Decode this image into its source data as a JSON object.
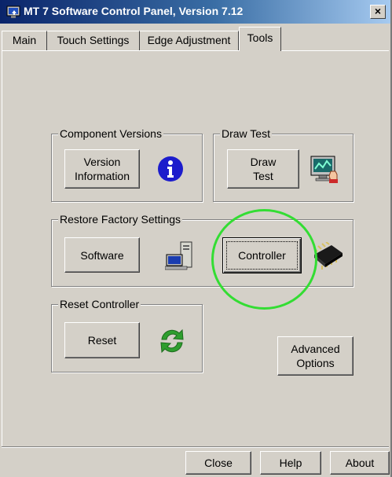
{
  "window": {
    "title": "MT 7 Software Control Panel, Version 7.12",
    "close_glyph": "×"
  },
  "tabs": [
    {
      "label": "Main",
      "active": false
    },
    {
      "label": "Touch Settings",
      "active": false
    },
    {
      "label": "Edge Adjustment",
      "active": false
    },
    {
      "label": "Tools",
      "active": true
    }
  ],
  "groups": {
    "component_versions": {
      "legend": "Component Versions",
      "button_line1": "Version",
      "button_line2": "Information",
      "icon": "info-icon"
    },
    "draw_test": {
      "legend": "Draw Test",
      "button_line1": "Draw",
      "button_line2": "Test",
      "icon": "monitor-draw-icon"
    },
    "restore_factory": {
      "legend": "Restore Factory Settings",
      "software_label": "Software",
      "controller_label": "Controller",
      "software_icon": "computer-icon",
      "controller_icon": "chip-icon"
    },
    "reset_controller": {
      "legend": "Reset Controller",
      "button_label": "Reset",
      "icon": "refresh-icon"
    }
  },
  "advanced": {
    "line1": "Advanced",
    "line2": "Options"
  },
  "footer": {
    "close": "Close",
    "help": "Help",
    "about": "About"
  },
  "colors": {
    "face": "#d4d0c8",
    "title_start": "#0a246a",
    "title_end": "#a6caf0",
    "info_blue": "#1c1ccc",
    "refresh_green": "#2e9e2e",
    "highlight_circle": "#33dd33"
  }
}
